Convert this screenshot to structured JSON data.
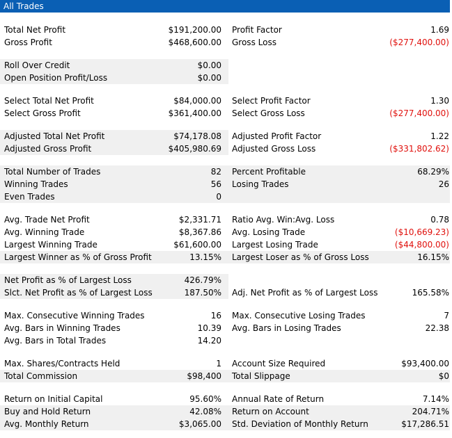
{
  "header": {
    "title": "All Trades"
  },
  "colors": {
    "header_bg": "#0a5fb4",
    "negative": "#e0100c",
    "shade": "#f0f0f0"
  },
  "sections": [
    {
      "rows": [
        {
          "l1": "Total Net Profit",
          "v1": "$191,200.00",
          "l2": "Profit Factor",
          "v2": "1.69"
        },
        {
          "l1": "Gross Profit",
          "v1": "$468,600.00",
          "l2": "Gross Loss",
          "v2": "($277,400.00)"
        }
      ]
    },
    {
      "rows": [
        {
          "l1": "Roll Over Credit",
          "v1": "$0.00",
          "l2": "",
          "v2": ""
        },
        {
          "l1": "Open Position Profit/Loss",
          "v1": "$0.00",
          "l2": "",
          "v2": ""
        }
      ]
    },
    {
      "rows": [
        {
          "l1": "Select Total Net Profit",
          "v1": "$84,000.00",
          "l2": "Select Profit Factor",
          "v2": "1.30"
        },
        {
          "l1": "Select Gross Profit",
          "v1": "$361,400.00",
          "l2": "Select Gross Loss",
          "v2": "($277,400.00)"
        }
      ]
    },
    {
      "rows": [
        {
          "l1": "Adjusted Total Net Profit",
          "v1": "$74,178.08",
          "l2": "Adjusted Profit Factor",
          "v2": "1.22"
        },
        {
          "l1": "Adjusted Gross Profit",
          "v1": "$405,980.69",
          "l2": "Adjusted Gross Loss",
          "v2": "($331,802.62)"
        }
      ]
    },
    {
      "rows": [
        {
          "l1": "Total Number of Trades",
          "v1": "82",
          "l2": "Percent Profitable",
          "v2": "68.29%"
        },
        {
          "l1": "Winning Trades",
          "v1": "56",
          "l2": "Losing Trades",
          "v2": "26"
        },
        {
          "l1": "Even Trades",
          "v1": "0",
          "l2": "",
          "v2": ""
        }
      ]
    },
    {
      "rows": [
        {
          "l1": "Avg. Trade Net Profit",
          "v1": "$2,331.71",
          "l2": "Ratio Avg. Win:Avg. Loss",
          "v2": "0.78"
        },
        {
          "l1": "Avg. Winning Trade",
          "v1": "$8,367.86",
          "l2": "Avg. Losing Trade",
          "v2": "($10,669.23)"
        },
        {
          "l1": "Largest Winning Trade",
          "v1": "$61,600.00",
          "l2": "Largest Losing Trade",
          "v2": "($44,800.00)"
        },
        {
          "l1": "Largest Winner as % of Gross Profit",
          "v1": "13.15%",
          "l2": "Largest Loser as % of Gross Loss",
          "v2": "16.15%"
        }
      ]
    },
    {
      "rows": [
        {
          "l1": "Net Profit as % of Largest Loss",
          "v1": "426.79%",
          "l2": "",
          "v2": ""
        },
        {
          "l1": "Slct. Net Profit as % of Largest Loss",
          "v1": "187.50%",
          "l2": "Adj. Net Profit as % of Largest Loss",
          "v2": "165.58%"
        }
      ]
    },
    {
      "rows": [
        {
          "l1": "Max. Consecutive Winning Trades",
          "v1": "16",
          "l2": "Max. Consecutive Losing Trades",
          "v2": "7"
        },
        {
          "l1": "Avg. Bars in Winning Trades",
          "v1": "10.39",
          "l2": "Avg. Bars in Losing Trades",
          "v2": "22.38"
        },
        {
          "l1": "Avg. Bars in Total Trades",
          "v1": "14.20",
          "l2": "",
          "v2": ""
        }
      ]
    },
    {
      "rows": [
        {
          "l1": "Max. Shares/Contracts Held",
          "v1": "1",
          "l2": "Account Size Required",
          "v2": "$93,400.00"
        },
        {
          "l1": "Total Commission",
          "v1": "$98,400",
          "l2": "Total Slippage",
          "v2": "$0"
        }
      ]
    },
    {
      "rows": [
        {
          "l1": "Return on Initial Capital",
          "v1": "95.60%",
          "l2": "Annual Rate of Return",
          "v2": "7.14%"
        },
        {
          "l1": "Buy and Hold Return",
          "v1": "42.08%",
          "l2": "Return on Account",
          "v2": "204.71%"
        },
        {
          "l1": "Avg. Monthly Return",
          "v1": "$3,065.00",
          "l2": "Std. Deviation of Monthly Return",
          "v2": "$17,286.51"
        }
      ]
    }
  ]
}
